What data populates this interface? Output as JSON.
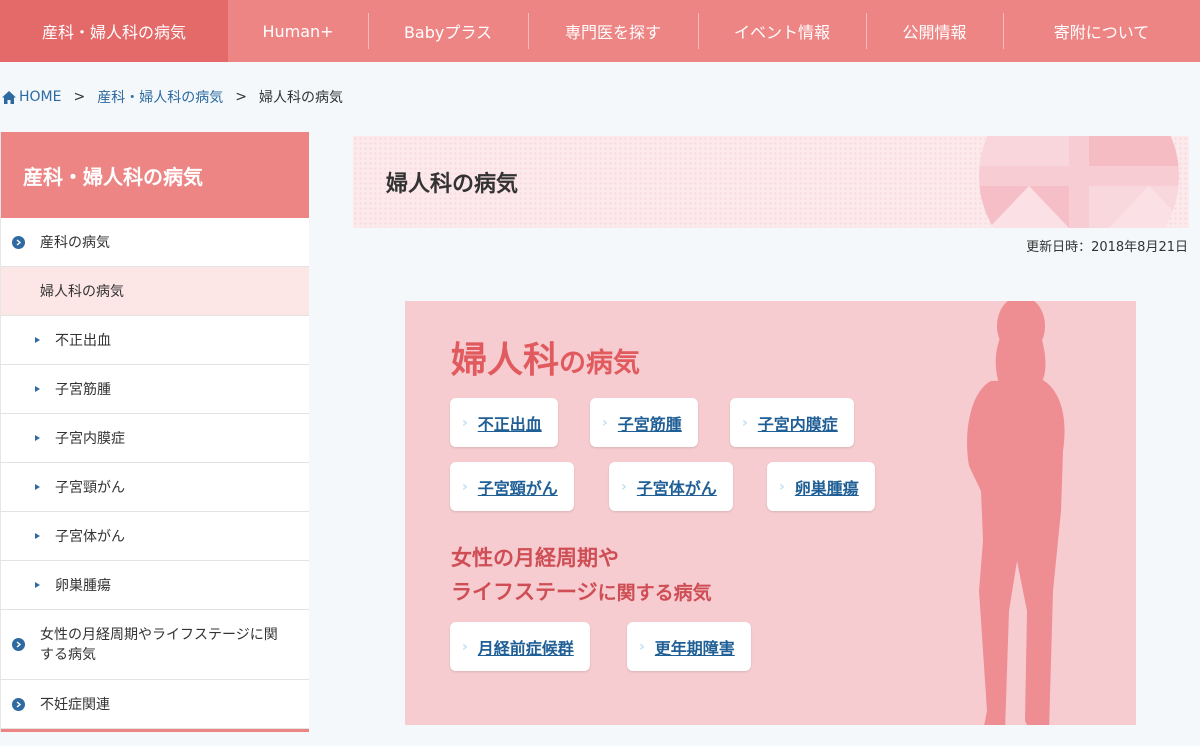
{
  "nav": {
    "items": [
      {
        "label": "産科・婦人科の病気"
      },
      {
        "label": "Human+"
      },
      {
        "label": "Babyプラス"
      },
      {
        "label": "専門医を探す"
      },
      {
        "label": "イベント情報"
      },
      {
        "label": "公開情報"
      },
      {
        "label": "寄附について"
      }
    ]
  },
  "breadcrumb": {
    "home": "HOME",
    "sep": ">",
    "parent": "産科・婦人科の病気",
    "current": "婦人科の病気"
  },
  "sidebar": {
    "title": "産科・婦人科の病気",
    "items": [
      {
        "label": "産科の病気"
      },
      {
        "label": "婦人科の病気"
      },
      {
        "label": "不正出血"
      },
      {
        "label": "子宮筋腫"
      },
      {
        "label": "子宮内膜症"
      },
      {
        "label": "子宮頸がん"
      },
      {
        "label": "子宮体がん"
      },
      {
        "label": "卵巣腫瘍"
      },
      {
        "label": "女性の月経周期やライフステージに関する病気"
      },
      {
        "label": "不妊症関連"
      }
    ]
  },
  "main": {
    "title": "婦人科の病気",
    "updated": "更新日時：2018年8月21日"
  },
  "panel": {
    "title_big": "婦人科",
    "title_small": "の病気",
    "tags": [
      {
        "label": "不正出血"
      },
      {
        "label": "子宮筋腫"
      },
      {
        "label": "子宮内膜症"
      },
      {
        "label": "子宮頸がん"
      },
      {
        "label": "子宮体がん"
      },
      {
        "label": "卵巣腫瘍"
      }
    ],
    "subtitle_line1": "女性の月経周期や",
    "subtitle_line2a": "ライフステージ",
    "subtitle_line2b": "に関する病気",
    "sub_tags": [
      {
        "label": "月経前症候群"
      },
      {
        "label": "更年期障害"
      }
    ]
  },
  "colors": {
    "accent": "#ee8585",
    "link": "#2c6aa0",
    "panel": "#f6ccd0"
  }
}
